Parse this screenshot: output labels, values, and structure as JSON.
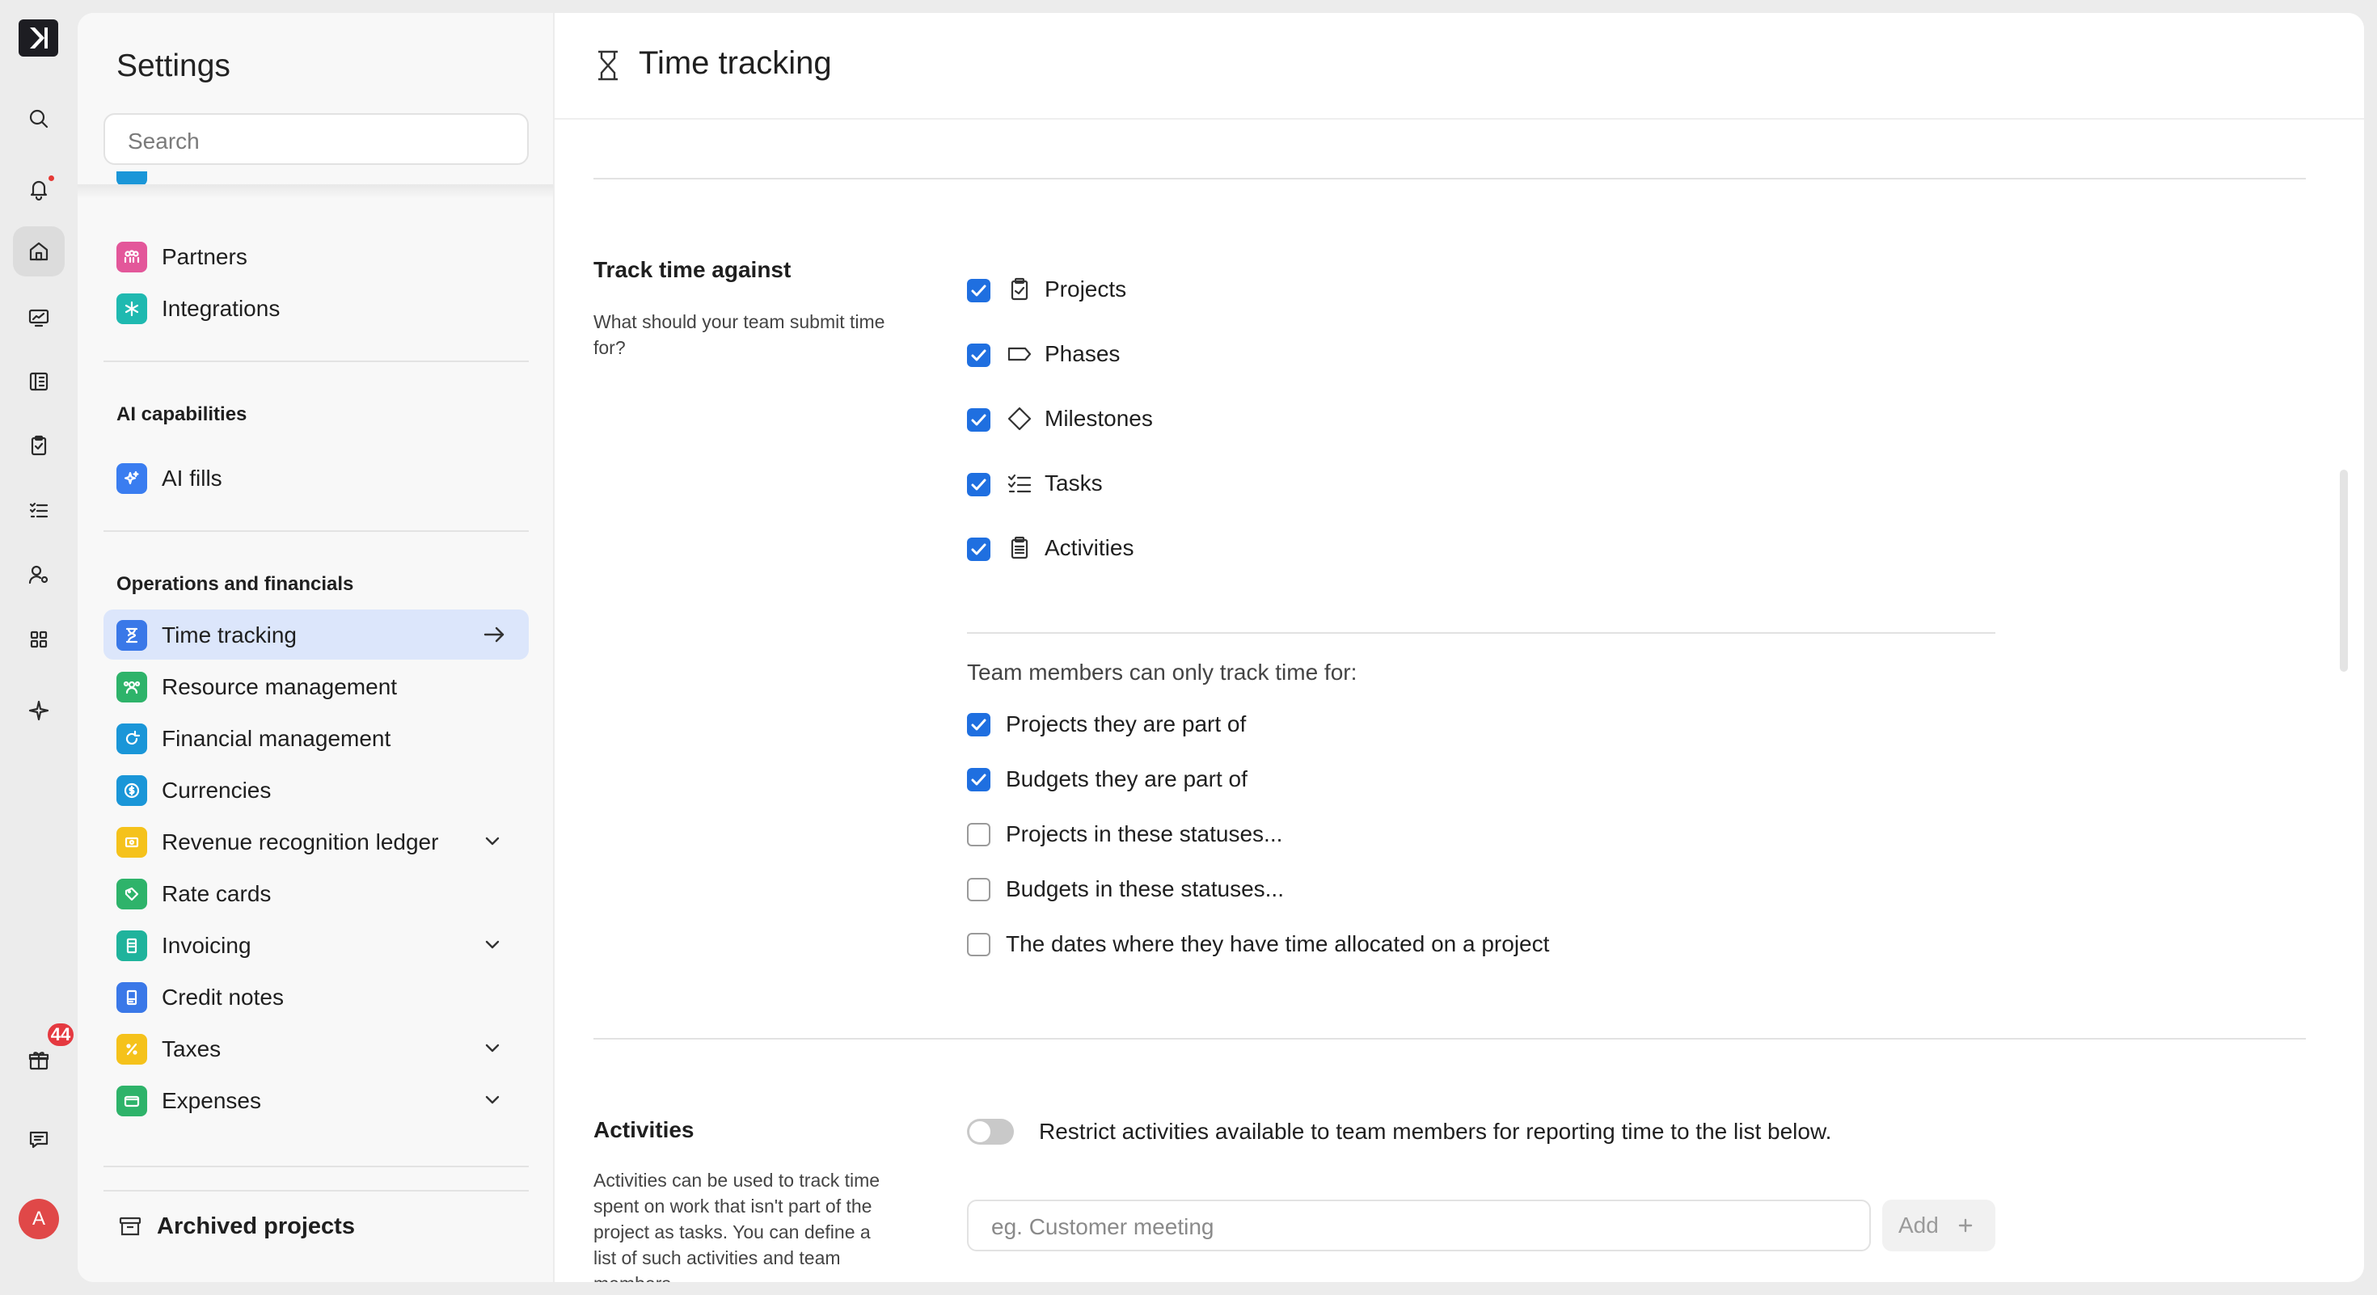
{
  "rail": {
    "items": [
      "search-icon",
      "bell-icon",
      "home-icon",
      "monitor-chart-icon",
      "building-icon",
      "clipboard-check-icon",
      "checklist-icon",
      "user-gear-icon",
      "grid-icon",
      "sparkle-icon",
      "gift-icon",
      "chat-icon"
    ],
    "gift_badge": "44",
    "avatar_letter": "A"
  },
  "sidebar": {
    "title": "Settings",
    "search_placeholder": "Search",
    "top_items": [
      {
        "label": "Partners",
        "color": "#e3579a",
        "icon": "people-icon"
      },
      {
        "label": "Integrations",
        "color": "#1fb9b0",
        "icon": "snowflake-icon"
      }
    ],
    "ai_section": "AI capabilities",
    "ai_items": [
      {
        "label": "AI fills",
        "color": "#3a7df0",
        "icon": "sparkles-icon"
      }
    ],
    "ops_section": "Operations and financials",
    "ops_items": [
      {
        "label": "Time tracking",
        "color": "#3a78e8",
        "icon": "hourglass-icon",
        "selected": true
      },
      {
        "label": "Resource management",
        "color": "#2eb36a",
        "icon": "team-icon"
      },
      {
        "label": "Financial management",
        "color": "#1a96d8",
        "icon": "refresh-icon"
      },
      {
        "label": "Currencies",
        "color": "#1a96d8",
        "icon": "coin-icon"
      },
      {
        "label": "Revenue recognition ledger",
        "color": "#f5c21b",
        "icon": "ledger-icon",
        "expandable": true
      },
      {
        "label": "Rate cards",
        "color": "#2eb36a",
        "icon": "tag-icon"
      },
      {
        "label": "Invoicing",
        "color": "#1fb39c",
        "icon": "invoice-icon",
        "expandable": true
      },
      {
        "label": "Credit notes",
        "color": "#3a78e8",
        "icon": "note-icon"
      },
      {
        "label": "Taxes",
        "color": "#f5c21b",
        "icon": "percent-icon",
        "expandable": true
      },
      {
        "label": "Expenses",
        "color": "#2eb36a",
        "icon": "wallet-icon",
        "expandable": true
      }
    ],
    "archived": "Archived projects"
  },
  "page": {
    "title": "Time tracking",
    "track": {
      "title": "Track time against",
      "desc": "What should your team submit time for?",
      "items": [
        {
          "label": "Projects",
          "icon": "clipboard-icon",
          "checked": true
        },
        {
          "label": "Phases",
          "icon": "tag-outline-icon",
          "checked": true
        },
        {
          "label": "Milestones",
          "icon": "diamond-icon",
          "checked": true
        },
        {
          "label": "Tasks",
          "icon": "task-list-icon",
          "checked": true
        },
        {
          "label": "Activities",
          "icon": "clipboard-list-icon",
          "checked": true
        }
      ]
    },
    "restrict": {
      "heading": "Team members can only track time for:",
      "items": [
        {
          "label": "Projects they are part of",
          "checked": true
        },
        {
          "label": "Budgets they are part of",
          "checked": true
        },
        {
          "label": "Projects in these statuses...",
          "checked": false
        },
        {
          "label": "Budgets in these statuses...",
          "checked": false
        },
        {
          "label": "The dates where they have time allocated on a project",
          "checked": false
        }
      ]
    },
    "activities": {
      "title": "Activities",
      "desc": "Activities can be used to track time spent on work that isn't part of the project as tasks. You can define a list of such activities and team members",
      "toggle_label": "Restrict activities available to team members for reporting time to the list below.",
      "toggle_on": false,
      "input_placeholder": "eg. Customer meeting",
      "add_label": "Add"
    }
  }
}
